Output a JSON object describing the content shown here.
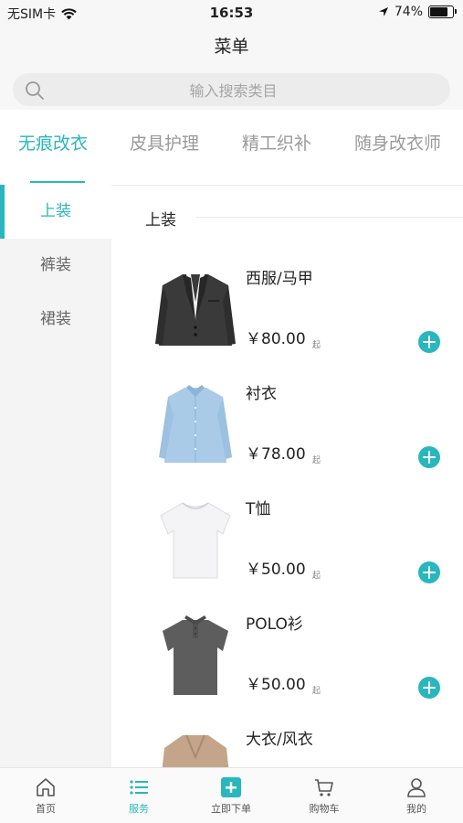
{
  "status_bar": {
    "carrier": "无SIM卡",
    "time": "16:53",
    "battery": "74%"
  },
  "nav": {
    "title": "菜单"
  },
  "search": {
    "placeholder": "输入搜索类目"
  },
  "tabs": [
    {
      "label": "无痕改衣",
      "active": true
    },
    {
      "label": "皮具护理",
      "active": false
    },
    {
      "label": "精工织补",
      "active": false
    },
    {
      "label": "随身改衣师",
      "active": false
    }
  ],
  "sidebar": [
    {
      "label": "上装",
      "active": true
    },
    {
      "label": "裤装",
      "active": false
    },
    {
      "label": "裙装",
      "active": false
    }
  ],
  "section": {
    "title": "上装"
  },
  "products": [
    {
      "name": "西服/马甲",
      "price": "￥80.00",
      "suffix": "起",
      "image": "suit-jacket"
    },
    {
      "name": "衬衣",
      "price": "￥78.00",
      "suffix": "起",
      "image": "dress-shirt"
    },
    {
      "name": "T恤",
      "price": "￥50.00",
      "suffix": "起",
      "image": "t-shirt"
    },
    {
      "name": "POLO衫",
      "price": "￥50.00",
      "suffix": "起",
      "image": "polo-shirt"
    },
    {
      "name": "大衣/风衣",
      "price": "",
      "suffix": "",
      "image": "trench-coat"
    }
  ],
  "tabbar": [
    {
      "label": "首页",
      "icon": "home-icon",
      "active": false
    },
    {
      "label": "服务",
      "icon": "list-icon",
      "active": true
    },
    {
      "label": "立即下单",
      "icon": "plus-square-icon",
      "active": false
    },
    {
      "label": "购物车",
      "icon": "cart-icon",
      "active": false
    },
    {
      "label": "我的",
      "icon": "user-icon",
      "active": false
    }
  ],
  "colors": {
    "accent": "#2ab6bd",
    "sidebar_bg": "#f4f4f4",
    "bar_bg": "#f7f7f7"
  }
}
